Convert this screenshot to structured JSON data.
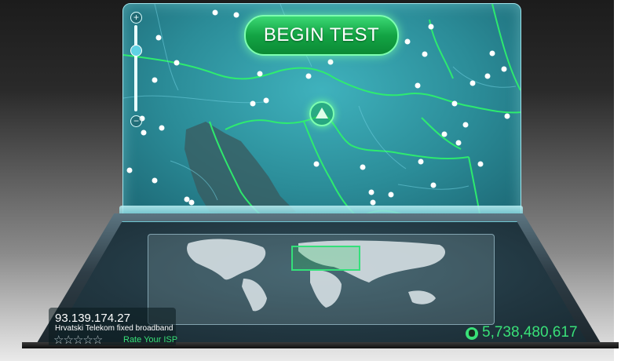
{
  "map": {
    "begin_label": "BEGIN TEST",
    "zoom_plus": "+",
    "zoom_minus": "−",
    "accent_color": "#1ed760",
    "server_icon": "server-triangle-icon"
  },
  "isp": {
    "ip": "93.139.174.27",
    "provider": "Hrvatski Telekom fixed broadband",
    "stars": "☆☆☆☆☆",
    "rate_label": "Rate Your ISP"
  },
  "counter": {
    "icon": "globe-icon",
    "value": "5,738,480,617"
  }
}
